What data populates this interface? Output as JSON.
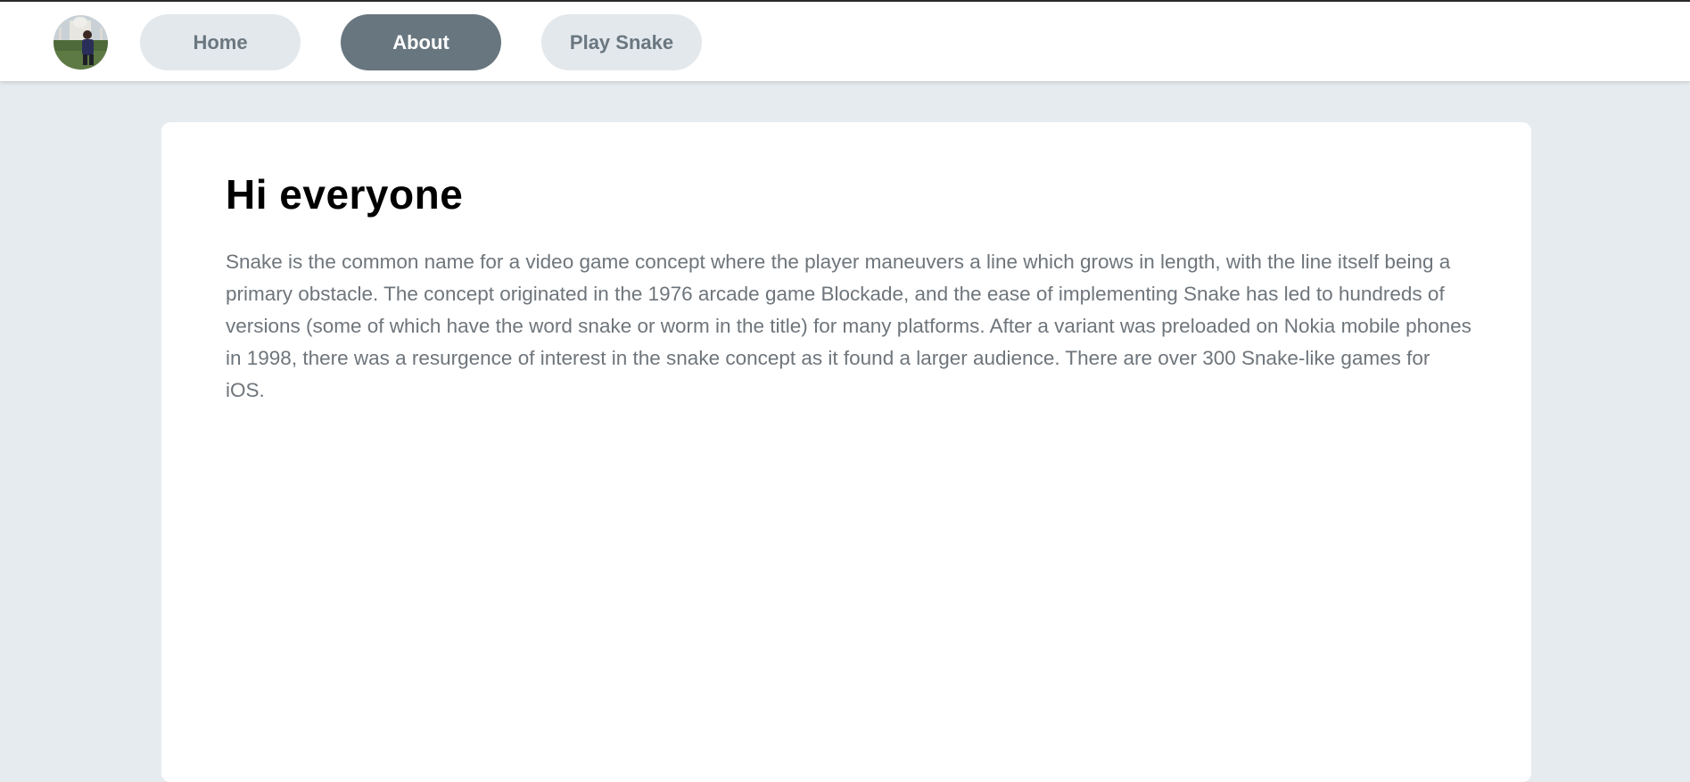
{
  "nav": {
    "avatar_alt": "profile photo",
    "items": [
      {
        "label": "Home",
        "active": false
      },
      {
        "label": "About",
        "active": true
      },
      {
        "label": "Play Snake",
        "active": false
      }
    ]
  },
  "content": {
    "heading": "Hi everyone",
    "body": "Snake is the common name for a video game concept where the player maneuvers a line which grows in length, with the line itself being a primary obstacle. The concept originated in the 1976 arcade game Blockade, and the ease of implementing Snake has led to hundreds of versions (some of which have the word snake or worm in the title) for many platforms. After a variant was preloaded on Nokia mobile phones in 1998, there was a resurgence of interest in the snake concept as it found a larger audience. There are over 300 Snake-like games for iOS."
  },
  "colors": {
    "page_background": "#e6ebef",
    "nav_button": "#e3e8ec",
    "nav_button_active": "#68767f",
    "body_text": "#6e757b"
  }
}
